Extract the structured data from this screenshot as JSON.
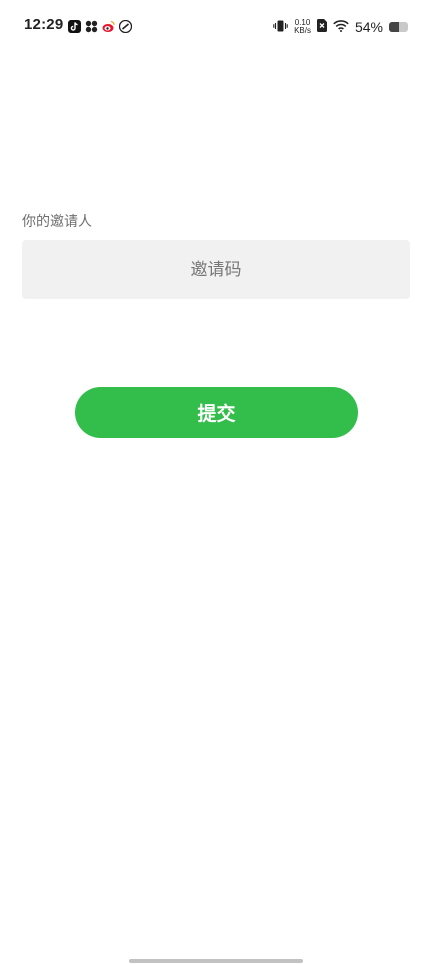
{
  "status_bar": {
    "time": "12:29",
    "notification_icons": [
      "tiktok-icon",
      "app-grid-icon",
      "weibo-icon",
      "link-app-icon"
    ],
    "net_speed_value": "0.10",
    "net_speed_unit": "KB/s",
    "battery_percent": "54%",
    "battery_level": 0.54
  },
  "form": {
    "inviter_label": "你的邀请人",
    "invite_code_placeholder": "邀请码",
    "invite_code_value": "",
    "submit_label": "提交"
  },
  "colors": {
    "accent": "#33bd4b",
    "input_bg": "#f1f1f2",
    "label_text": "#6e6e6e"
  }
}
